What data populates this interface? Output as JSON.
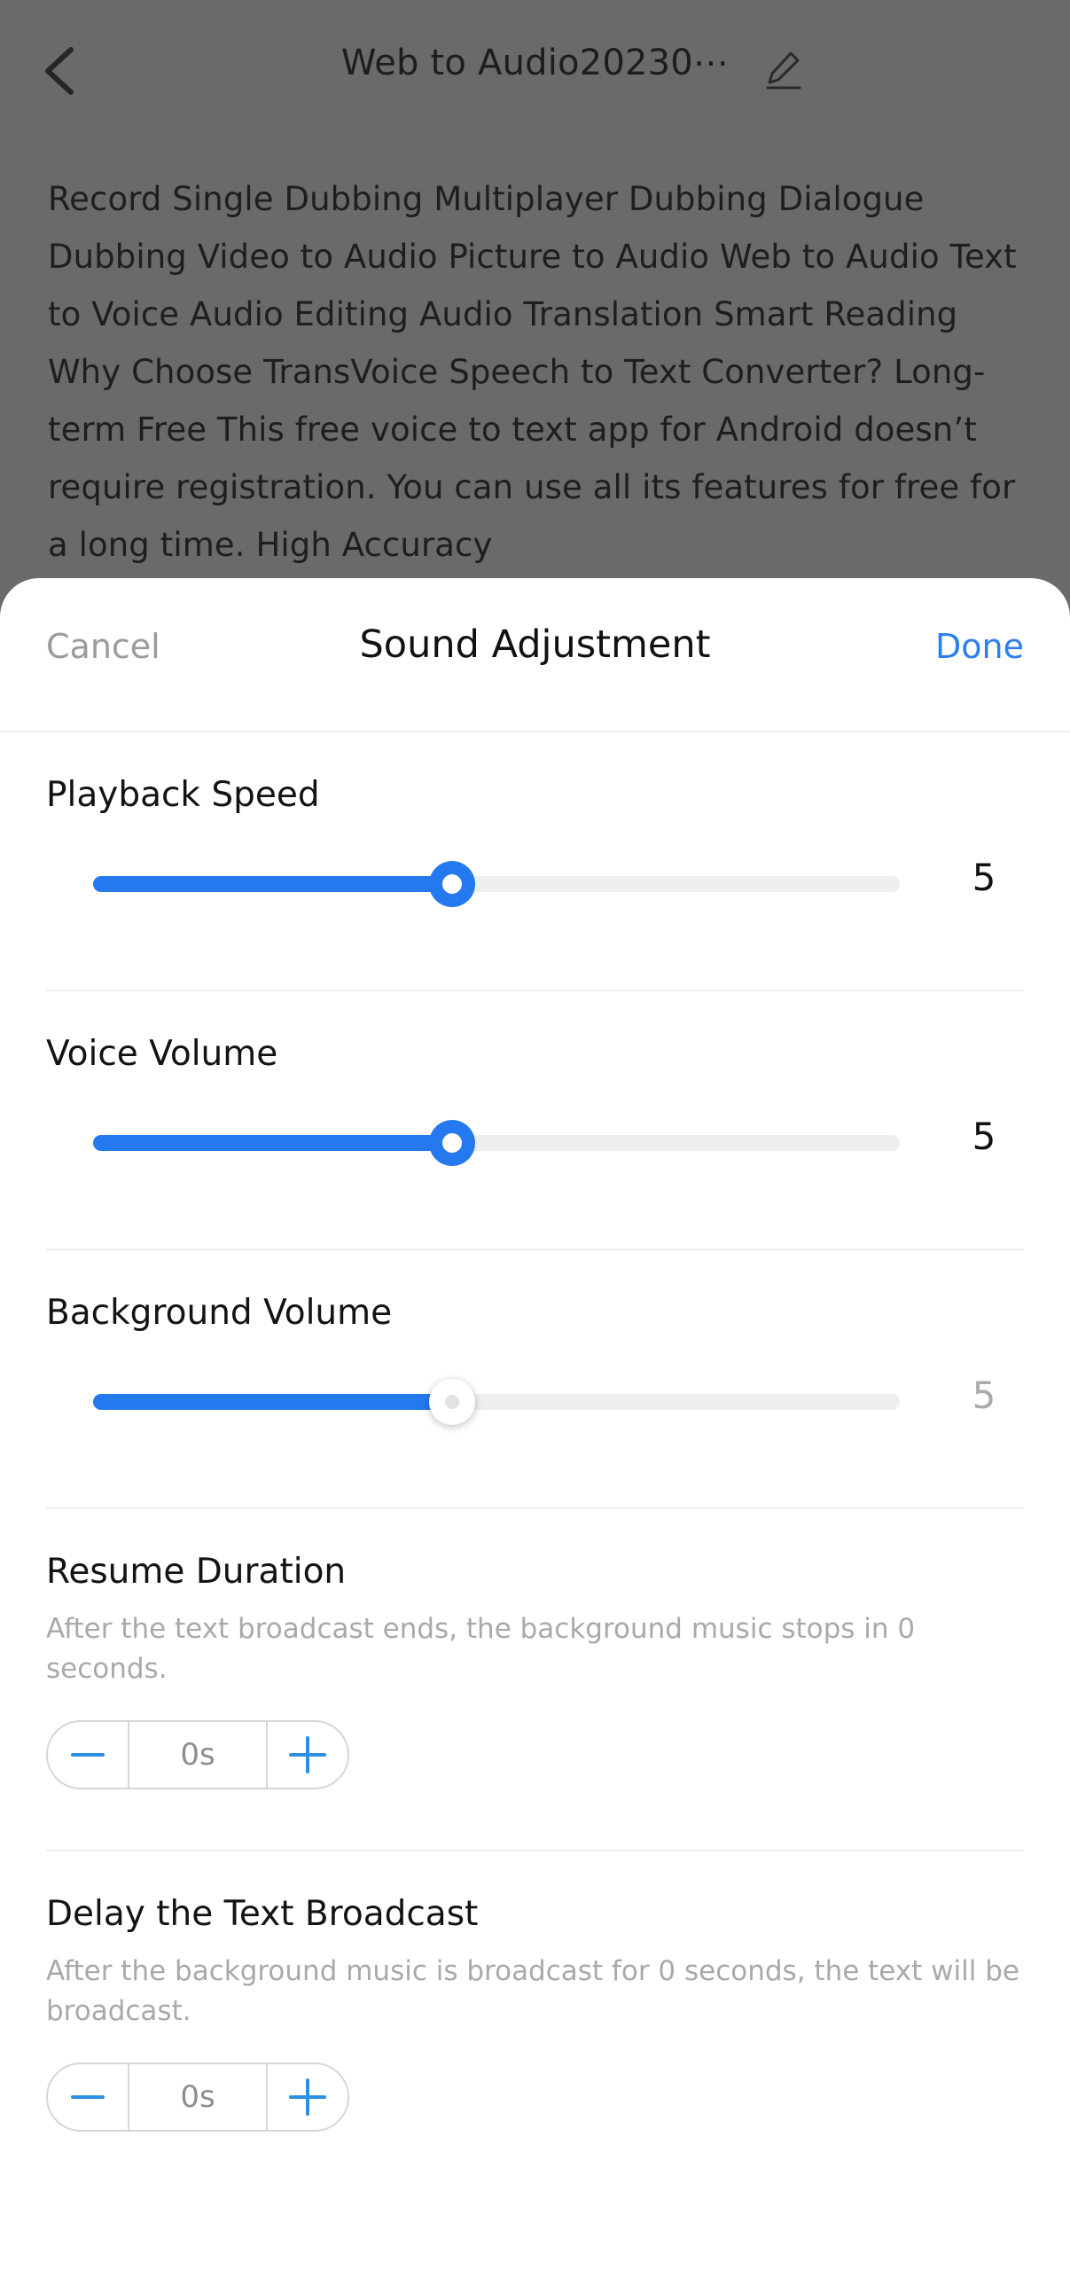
{
  "background_page": {
    "back_icon": "chevron-left-icon",
    "title": "Web to Audio20230⋯",
    "edit_icon": "pencil-edit-icon",
    "body_text": "Record Single Dubbing Multiplayer Dubbing Dialogue Dubbing Video to Audio Picture to Audio Web to Audio Text to Voice Audio Editing Audio Translation Smart Reading Why Choose TransVoice Speech to Text Converter? Long-term Free This free voice to text app for Android doesn’t require registration. You can use all its features for free for a long time. High Accuracy"
  },
  "sheet": {
    "header": {
      "cancel_label": "Cancel",
      "title": "Sound Adjustment",
      "done_label": "Done"
    },
    "sliders": [
      {
        "label": "Playback Speed",
        "value": "5",
        "percent": 44.5,
        "disabled": false
      },
      {
        "label": "Voice Volume",
        "value": "5",
        "percent": 44.5,
        "disabled": false
      },
      {
        "label": "Background Volume",
        "value": "5",
        "percent": 44.5,
        "disabled": true
      }
    ],
    "steppers": [
      {
        "title": "Resume Duration",
        "description": "After the text broadcast ends, the background music stops in 0 seconds.",
        "value": "0s",
        "minus_label": "minus-icon",
        "plus_label": "plus-icon"
      },
      {
        "title": "Delay the Text Broadcast",
        "description": "After the background music is broadcast for 0 seconds, the text will be broadcast.",
        "value": "0s",
        "minus_label": "minus-icon",
        "plus_label": "plus-icon"
      }
    ]
  },
  "colors": {
    "accent_blue": "#2579ee",
    "link_blue": "#2d7ff0",
    "track_gray": "#efefef",
    "scrim": "#6a6a6a",
    "muted_text": "#a9a9a9"
  }
}
